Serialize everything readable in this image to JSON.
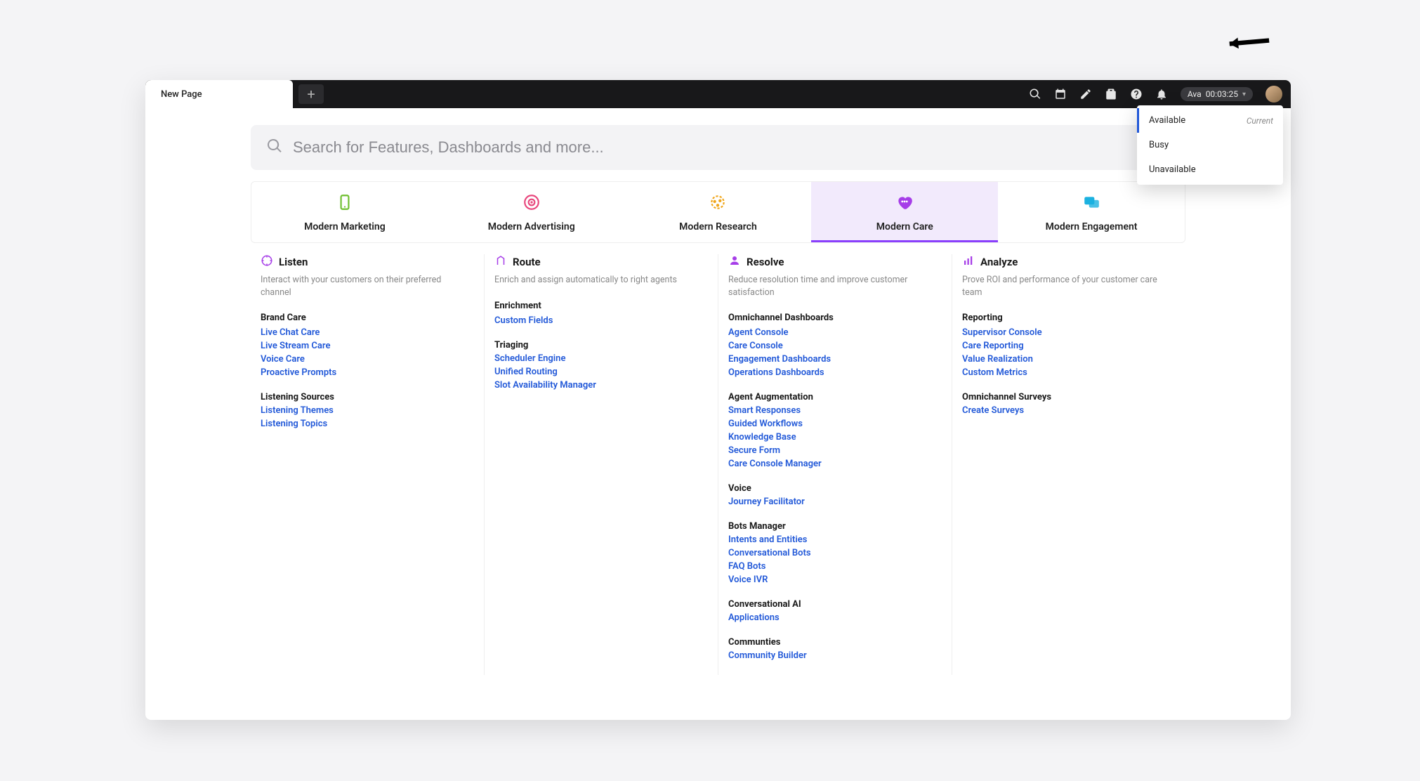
{
  "tab_title": "New Page",
  "search_placeholder": "Search for Features, Dashboards and more...",
  "user": {
    "name": "Ava",
    "timer": "00:03:25"
  },
  "status_menu": [
    {
      "label": "Available",
      "current": true
    },
    {
      "label": "Busy",
      "current": false
    },
    {
      "label": "Unavailable",
      "current": false
    }
  ],
  "current_label": "Current",
  "product_tabs": [
    {
      "key": "marketing",
      "label": "Modern Marketing",
      "color": "#6fbf2f",
      "active": false
    },
    {
      "key": "advertising",
      "label": "Modern Advertising",
      "color": "#e8467c",
      "active": false
    },
    {
      "key": "research",
      "label": "Modern Research",
      "color": "#f0a61a",
      "active": false
    },
    {
      "key": "care",
      "label": "Modern Care",
      "color": "#a63de8",
      "active": true
    },
    {
      "key": "engagement",
      "label": "Modern Engagement",
      "color": "#1bb1e0",
      "active": false
    }
  ],
  "columns": [
    {
      "key": "listen",
      "title": "Listen",
      "icon_color": "#a63de8",
      "desc": "Interact with your customers on their preferred channel",
      "groups": [
        {
          "title": "Brand Care",
          "links": [
            "Live Chat Care",
            "Live Stream Care",
            "Voice Care",
            "Proactive Prompts"
          ]
        },
        {
          "title": "Listening Sources",
          "links": [
            "Listening Themes",
            "Listening Topics"
          ]
        }
      ]
    },
    {
      "key": "route",
      "title": "Route",
      "icon_color": "#a63de8",
      "desc": "Enrich and assign automatically to right agents",
      "groups": [
        {
          "title": "Enrichment",
          "links": [
            "Custom Fields"
          ]
        },
        {
          "title": "Triaging",
          "links": [
            "Scheduler Engine",
            "Unified Routing",
            "Slot Availability Manager"
          ]
        }
      ]
    },
    {
      "key": "resolve",
      "title": "Resolve",
      "icon_color": "#a63de8",
      "desc": "Reduce resolution time and improve customer satisfaction",
      "groups": [
        {
          "title": "Omnichannel Dashboards",
          "links": [
            "Agent Console",
            "Care Console",
            "Engagement Dashboards",
            "Operations Dashboards"
          ]
        },
        {
          "title": "Agent Augmentation",
          "links": [
            "Smart Responses",
            "Guided Workflows",
            "Knowledge Base",
            "Secure Form",
            "Care Console Manager"
          ]
        },
        {
          "title": "Voice",
          "links": [
            "Journey Facilitator"
          ]
        },
        {
          "title": "Bots Manager",
          "links": [
            "Intents and Entities",
            "Conversational Bots",
            "FAQ Bots",
            "Voice IVR"
          ]
        },
        {
          "title": "Conversational AI",
          "links": [
            "Applications"
          ]
        },
        {
          "title": "Communties",
          "links": [
            "Community Builder"
          ]
        }
      ]
    },
    {
      "key": "analyze",
      "title": "Analyze",
      "icon_color": "#a63de8",
      "desc": "Prove ROI and performance of your customer care team",
      "groups": [
        {
          "title": "Reporting",
          "links": [
            "Supervisor Console",
            "Care Reporting",
            "Value Realization",
            "Custom Metrics"
          ]
        },
        {
          "title": "Omnichannel Surveys",
          "links": [
            "Create Surveys"
          ]
        }
      ]
    }
  ]
}
